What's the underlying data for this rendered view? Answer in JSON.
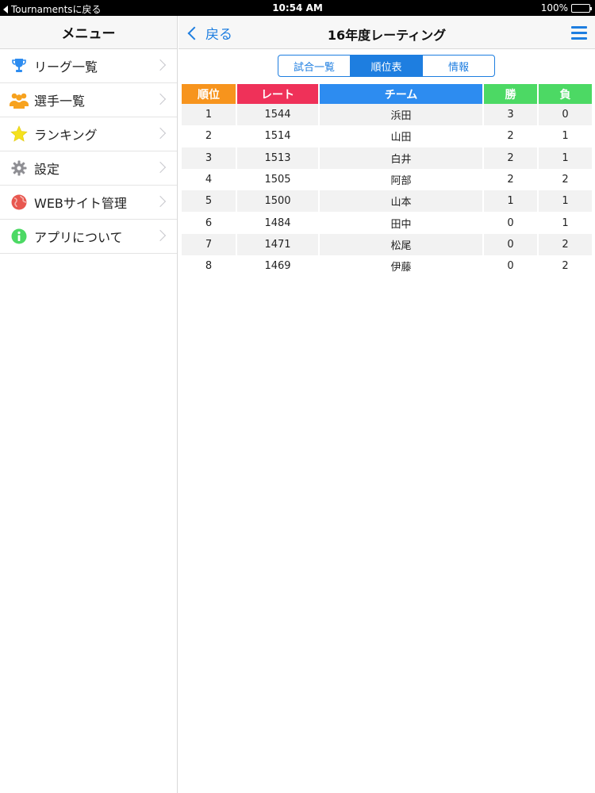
{
  "status_bar": {
    "back_label": "Tournamentsに戻る",
    "time": "10:54 AM",
    "battery": "100%",
    "battery_level": 1.0
  },
  "sidebar": {
    "title": "メニュー",
    "items": [
      {
        "label": "リーグ一覧",
        "icon": "trophy-icon",
        "color": "#2d8cf0"
      },
      {
        "label": "選手一覧",
        "icon": "people-icon",
        "color": "#f7a21e"
      },
      {
        "label": "ランキング",
        "icon": "star-icon",
        "color": "#f5e11e"
      },
      {
        "label": "設定",
        "icon": "gear-icon",
        "color": "#8e8e93"
      },
      {
        "label": "WEBサイト管理",
        "icon": "globe-icon",
        "color": "#e8574f"
      },
      {
        "label": "アプリについて",
        "icon": "info-icon",
        "color": "#4cd964"
      }
    ]
  },
  "navbar": {
    "back_label": "戻る",
    "title": "16年度レーティング"
  },
  "segments": {
    "items": [
      "試合一覧",
      "順位表",
      "情報"
    ],
    "selected": "順位表"
  },
  "table": {
    "headers": [
      "順位",
      "レート",
      "チーム",
      "勝",
      "負"
    ],
    "rows": [
      [
        "1",
        "1544",
        "浜田",
        "3",
        "0"
      ],
      [
        "2",
        "1514",
        "山田",
        "2",
        "1"
      ],
      [
        "3",
        "1513",
        "白井",
        "2",
        "1"
      ],
      [
        "4",
        "1505",
        "阿部",
        "2",
        "2"
      ],
      [
        "5",
        "1500",
        "山本",
        "1",
        "1"
      ],
      [
        "6",
        "1484",
        "田中",
        "0",
        "1"
      ],
      [
        "7",
        "1471",
        "松尾",
        "0",
        "2"
      ],
      [
        "8",
        "1469",
        "伊藤",
        "0",
        "2"
      ]
    ]
  },
  "colors": {
    "accent": "#1e7ee0",
    "rank_header": "#f7941d",
    "rate_header": "#ef3159",
    "team_header": "#2d8cf0",
    "win_lose_header": "#4cd964"
  }
}
